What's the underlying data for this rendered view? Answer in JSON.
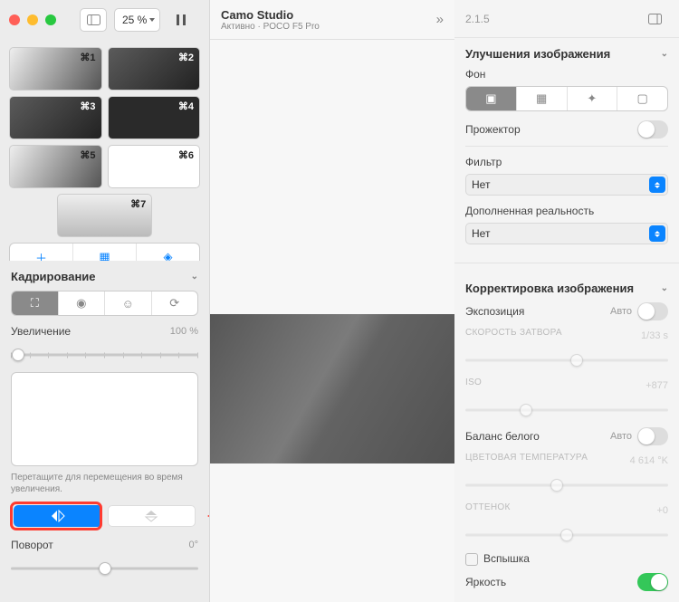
{
  "titlebar": {
    "zoom": "25 %",
    "pause_icon": "pause-icon",
    "sidebar_icon": "sidebar-toggle-icon"
  },
  "app": {
    "title": "Camo Studio",
    "status": "Активно · POCO F5 Pro",
    "version": "2.1.5"
  },
  "presets": [
    {
      "shortcut": "⌘1",
      "style": "grad"
    },
    {
      "shortcut": "⌘2",
      "style": "dark"
    },
    {
      "shortcut": "⌘3",
      "style": "dark"
    },
    {
      "shortcut": "⌘4",
      "style": "tmpl"
    },
    {
      "shortcut": "⌘5",
      "style": "grad"
    },
    {
      "shortcut": "⌘6",
      "style": "plain"
    },
    {
      "shortcut": "⌘7",
      "style": "wide"
    }
  ],
  "preset_actions": [
    "plus-icon",
    "grid-icon",
    "layers-icon"
  ],
  "crop": {
    "heading": "Кадрирование",
    "zoom_label": "Увеличение",
    "zoom_value": "100 %",
    "hint": "Перетащите для перемещения во время увеличения.",
    "rotate_label": "Поворот",
    "rotate_value": "0°"
  },
  "enhance": {
    "heading": "Улучшения изображения",
    "bg_label": "Фон",
    "spotlight_label": "Прожектор",
    "filter_label": "Фильтр",
    "filter_value": "Нет",
    "ar_label": "Дополненная реальность",
    "ar_value": "Нет"
  },
  "adjust": {
    "heading": "Корректировка изображения",
    "exposure_label": "Экспозиция",
    "auto_label": "Авто",
    "shutter_label": "СКОРОСТЬ ЗАТВОРА",
    "shutter_value": "1/33 s",
    "iso_label": "ISO",
    "iso_value": "+877",
    "wb_label": "Баланс белого",
    "temp_label": "ЦВЕТОВАЯ ТЕМПЕРАТУРА",
    "temp_value": "4 614 °K",
    "tint_label": "ОТТЕНОК",
    "tint_value": "+0",
    "flash_label": "Вспышка",
    "brightness_label": "Яркость"
  }
}
